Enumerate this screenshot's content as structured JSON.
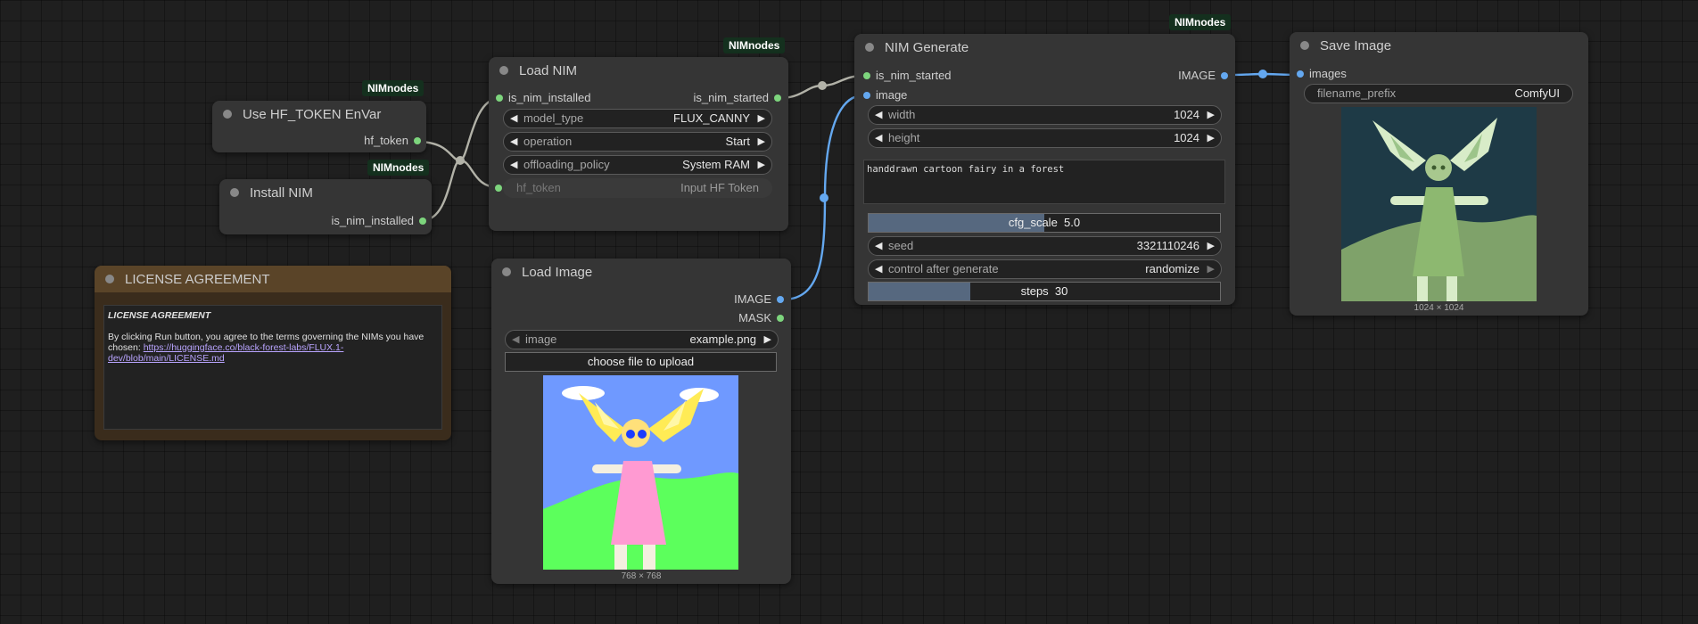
{
  "badges": {
    "hf": "NIMnodes",
    "install": "NIMnodes",
    "load_nim": "NIMnodes",
    "generate": "NIMnodes"
  },
  "hf_node": {
    "title": "Use HF_TOKEN EnVar",
    "output": "hf_token"
  },
  "install_node": {
    "title": "Install NIM",
    "output": "is_nim_installed"
  },
  "load_nim": {
    "title": "Load NIM",
    "input": "is_nim_installed",
    "output": "is_nim_started",
    "model_type_label": "model_type",
    "model_type_value": "FLUX_CANNY",
    "operation_label": "operation",
    "operation_value": "Start",
    "offloading_label": "offloading_policy",
    "offloading_value": "System RAM",
    "hf_token_label": "hf_token",
    "hf_token_value": "Input HF Token"
  },
  "license": {
    "title": "LICENSE AGREEMENT",
    "heading": "LICENSE AGREEMENT",
    "text": "By clicking Run button, you agree to the terms governing the NIMs you have chosen:",
    "link": "https://huggingface.co/black-forest-labs/FLUX.1-dev/blob/main/LICENSE.md"
  },
  "load_image": {
    "title": "Load Image",
    "out_image": "IMAGE",
    "out_mask": "MASK",
    "image_label": "image",
    "image_value": "example.png",
    "upload_label": "choose file to upload",
    "caption": "768 × 768"
  },
  "generate": {
    "title": "NIM Generate",
    "in_started": "is_nim_started",
    "in_image": "image",
    "output": "IMAGE",
    "width_label": "width",
    "width_value": "1024",
    "height_label": "height",
    "height_value": "1024",
    "prompt": "handdrawn cartoon fairy in a forest",
    "cfg_label": "cfg_scale",
    "cfg_value": "5.0",
    "cfg_fraction": 0.5,
    "seed_label": "seed",
    "seed_value": "3321110246",
    "control_label": "control after generate",
    "control_value": "randomize",
    "steps_label": "steps",
    "steps_value": "30",
    "steps_fraction": 0.29
  },
  "save": {
    "title": "Save Image",
    "input": "images",
    "prefix_label": "filename_prefix",
    "prefix_value": "ComfyUI",
    "caption": "1024 × 1024"
  },
  "colors": {
    "wire_grey": "#b2b2a8",
    "wire_blue": "#64a8f0",
    "slot_green": "#7dd57d"
  }
}
